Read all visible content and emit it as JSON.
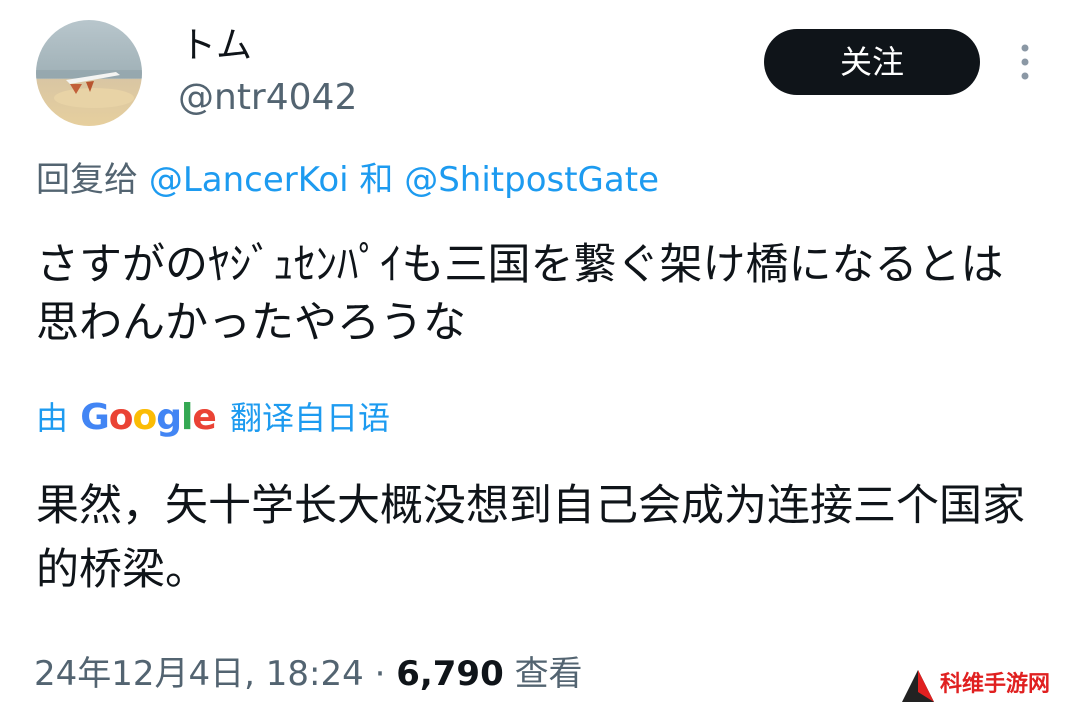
{
  "author": {
    "display_name": "トム",
    "handle": "@ntr4042"
  },
  "header": {
    "follow_label": "关注",
    "more_icon": "more-vertical-icon"
  },
  "reply": {
    "prefix": "回复给",
    "mention_1": "@LancerKoi",
    "conjunction": "和",
    "mention_2": "@ShitpostGate"
  },
  "tweet": {
    "text": "さすがのﾔｼﾞｭｾﾝﾊﾟｲも三国を繋ぐ架け橋になるとは思わんかったやろうな"
  },
  "translation": {
    "by": "由",
    "provider": "Google",
    "label": "翻译自日语",
    "text": "果然，矢十学长大概没想到自己会成为连接三个国家的桥梁。"
  },
  "meta": {
    "timestamp": "24年12月4日, 18:24",
    "separator": "·",
    "views_count": "6,790",
    "views_label": "查看"
  },
  "watermark": {
    "text": "科维手游网"
  },
  "colors": {
    "accent": "#1d9bf0",
    "text_primary": "#0f1419",
    "text_secondary": "#536471",
    "button_bg": "#0f1419",
    "watermark": "#e02020"
  }
}
